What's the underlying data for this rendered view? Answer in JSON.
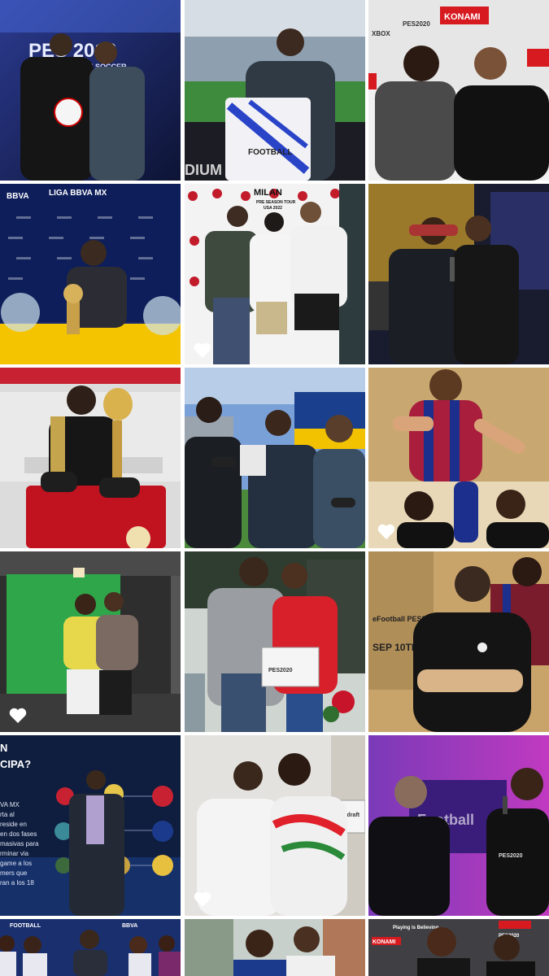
{
  "gallery": {
    "tiles": [
      {
        "id": "t1",
        "caption_text": [
          "PES 2016",
          "PRO EVOLUTION SOCCER"
        ],
        "brand": "PES"
      },
      {
        "id": "t2",
        "caption_text": [
          "FOOTBALL"
        ],
        "banner": "DIUM"
      },
      {
        "id": "t3",
        "caption_text": [
          "KONAMI",
          "PES2020",
          "XBOX"
        ]
      },
      {
        "id": "t4",
        "caption_text": [
          "BBVA",
          "LIGA BBVA MX"
        ]
      },
      {
        "id": "t5",
        "caption_text": [
          "MILAN",
          "PRE SEASON TOUR",
          "USA 2022"
        ]
      },
      {
        "id": "t6",
        "caption_text": []
      },
      {
        "id": "t7",
        "caption_text": []
      },
      {
        "id": "t8",
        "caption_text": []
      },
      {
        "id": "t9",
        "caption_text": []
      },
      {
        "id": "t10",
        "caption_text": []
      },
      {
        "id": "t11",
        "caption_text": [
          "PES2020"
        ]
      },
      {
        "id": "t12",
        "caption_text": [
          "eFootball PES2020",
          "SEP 10TH"
        ]
      },
      {
        "id": "t13",
        "caption_text": [
          "N",
          "CIPA?",
          "VA MX",
          "rta al",
          "reside en",
          "en dos fases",
          "masivas para",
          "rminar via",
          "game a los",
          "mers que",
          "ran a los 18"
        ]
      },
      {
        "id": "t14",
        "caption_text": [
          "updraft"
        ]
      },
      {
        "id": "t15",
        "caption_text": [
          "eFootball",
          "PES2020"
        ]
      },
      {
        "id": "t16",
        "caption_text": [
          "FOOTBALL",
          "BBVA"
        ]
      },
      {
        "id": "t17",
        "caption_text": []
      },
      {
        "id": "t18",
        "caption_text": [
          "KONAMI",
          "Playing is Believing",
          "PES2020"
        ]
      }
    ]
  },
  "ui": {
    "like_icon": "heart-icon",
    "accent": "#ffffff"
  }
}
